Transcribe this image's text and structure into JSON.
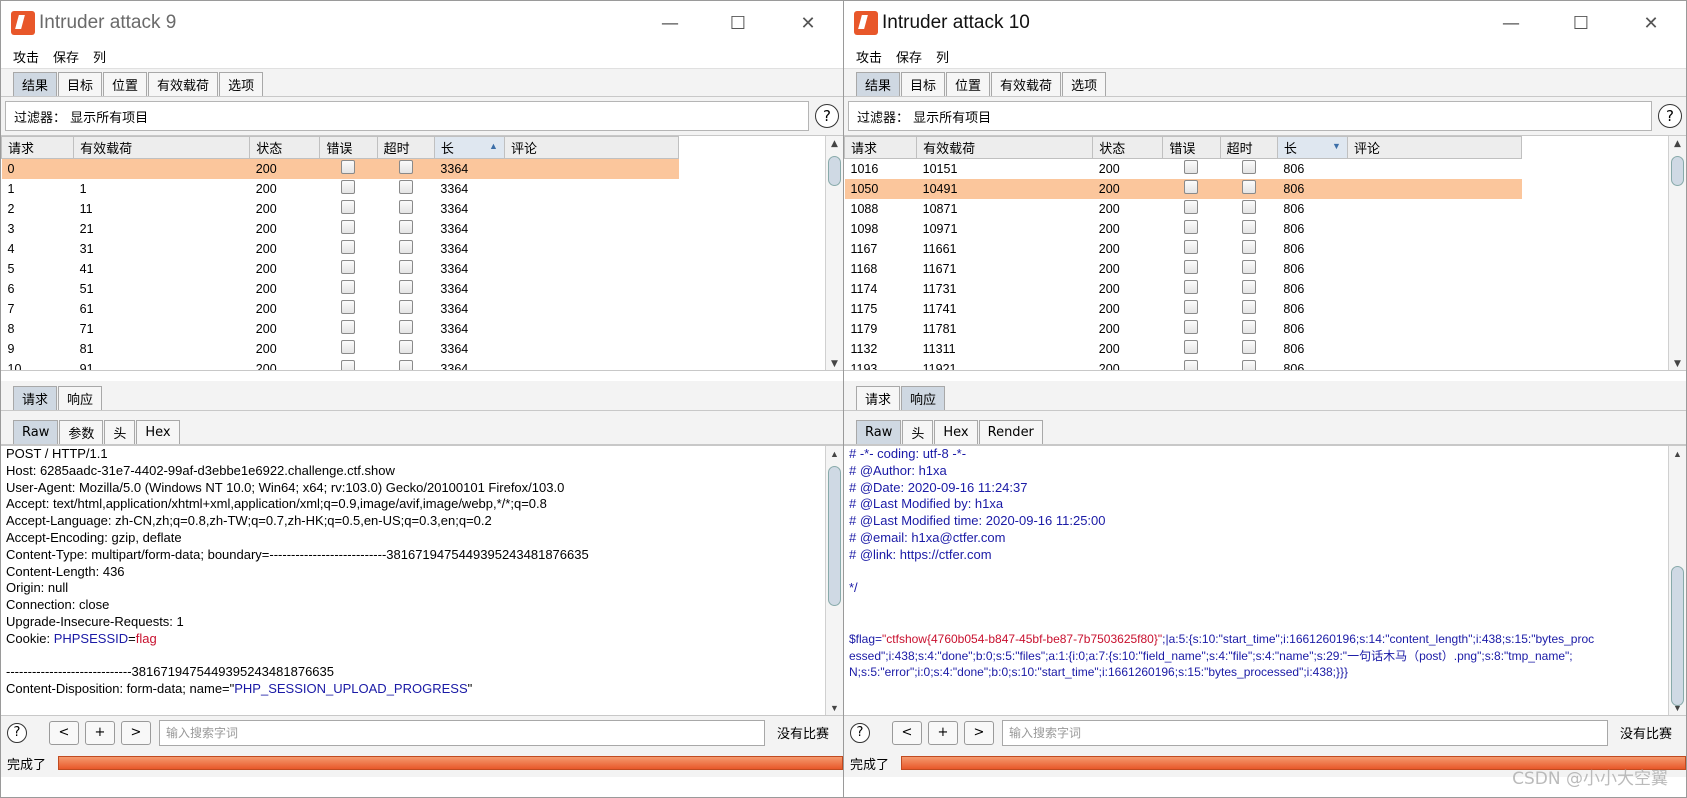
{
  "window1": {
    "title": "Intruder attack 9",
    "menu": [
      "攻击",
      "保存",
      "列"
    ],
    "tabs": [
      "结果",
      "目标",
      "位置",
      "有效载荷",
      "选项"
    ],
    "filter_label": "过滤器：  显示所有项目",
    "help_icon": "?",
    "columns": [
      "请求",
      "有效载荷",
      "状态",
      "错误",
      "超时",
      "长",
      "评论"
    ],
    "rows": [
      {
        "req": "0",
        "payload": "",
        "status": "200",
        "len": "3364",
        "selected": true
      },
      {
        "req": "1",
        "payload": "1",
        "status": "200",
        "len": "3364"
      },
      {
        "req": "2",
        "payload": "11",
        "status": "200",
        "len": "3364"
      },
      {
        "req": "3",
        "payload": "21",
        "status": "200",
        "len": "3364"
      },
      {
        "req": "4",
        "payload": "31",
        "status": "200",
        "len": "3364"
      },
      {
        "req": "5",
        "payload": "41",
        "status": "200",
        "len": "3364"
      },
      {
        "req": "6",
        "payload": "51",
        "status": "200",
        "len": "3364"
      },
      {
        "req": "7",
        "payload": "61",
        "status": "200",
        "len": "3364"
      },
      {
        "req": "8",
        "payload": "71",
        "status": "200",
        "len": "3364"
      },
      {
        "req": "9",
        "payload": "81",
        "status": "200",
        "len": "3364"
      },
      {
        "req": "10",
        "payload": "91",
        "status": "200",
        "len": "3364"
      }
    ],
    "sub_tabs": [
      "请求",
      "响应"
    ],
    "view_tabs": [
      "Raw",
      "参数",
      "头",
      "Hex"
    ],
    "request_lines": [
      "POST / HTTP/1.1",
      "Host: 6285aadc-31e7-4402-99af-d3ebbe1e6922.challenge.ctf.show",
      "User-Agent: Mozilla/5.0 (Windows NT 10.0; Win64; x64; rv:103.0) Gecko/20100101 Firefox/103.0",
      "Accept: text/html,application/xhtml+xml,application/xml;q=0.9,image/avif,image/webp,*/*;q=0.8",
      "Accept-Language: zh-CN,zh;q=0.8,zh-TW;q=0.7,zh-HK;q=0.5,en-US;q=0.3,en;q=0.2",
      "Accept-Encoding: gzip, deflate",
      "Content-Type: multipart/form-data; boundary=---------------------------3816719475449395243481876635",
      "Content-Length: 436",
      "Origin: null",
      "Connection: close",
      "Upgrade-Insecure-Requests: 1"
    ],
    "cookie_prefix": "Cookie: ",
    "cookie_name": "PHPSESSID",
    "cookie_eq": "=",
    "cookie_value": "flag",
    "boundary_line": "-----------------------------3816719475449395243481876635",
    "disposition_prefix": "Content-Disposition: form-data; name=\"",
    "disposition_name": "PHP_SESSION_UPLOAD_PROGRESS",
    "disposition_suffix": "\"",
    "nav_prev": "<",
    "nav_add": "+",
    "nav_next": ">",
    "search_placeholder": "输入搜索字词",
    "no_match": "没有比赛",
    "status": "完成了"
  },
  "window2": {
    "title": "Intruder attack 10",
    "menu": [
      "攻击",
      "保存",
      "列"
    ],
    "tabs": [
      "结果",
      "目标",
      "位置",
      "有效载荷",
      "选项"
    ],
    "filter_label": "过滤器：  显示所有项目",
    "help_icon": "?",
    "columns": [
      "请求",
      "有效载荷",
      "状态",
      "错误",
      "超时",
      "长",
      "评论"
    ],
    "rows": [
      {
        "req": "1016",
        "payload": "10151",
        "status": "200",
        "len": "806"
      },
      {
        "req": "1050",
        "payload": "10491",
        "status": "200",
        "len": "806",
        "selected": true
      },
      {
        "req": "1088",
        "payload": "10871",
        "status": "200",
        "len": "806"
      },
      {
        "req": "1098",
        "payload": "10971",
        "status": "200",
        "len": "806"
      },
      {
        "req": "1167",
        "payload": "11661",
        "status": "200",
        "len": "806"
      },
      {
        "req": "1168",
        "payload": "11671",
        "status": "200",
        "len": "806"
      },
      {
        "req": "1174",
        "payload": "11731",
        "status": "200",
        "len": "806"
      },
      {
        "req": "1175",
        "payload": "11741",
        "status": "200",
        "len": "806"
      },
      {
        "req": "1179",
        "payload": "11781",
        "status": "200",
        "len": "806"
      },
      {
        "req": "1132",
        "payload": "11311",
        "status": "200",
        "len": "806"
      },
      {
        "req": "1193",
        "payload": "11921",
        "status": "200",
        "len": "806"
      }
    ],
    "sub_tabs": [
      "请求",
      "响应"
    ],
    "view_tabs": [
      "Raw",
      "头",
      "Hex",
      "Render"
    ],
    "response_lines": [
      "# -*- coding: utf-8 -*-",
      "# @Author: h1xa",
      "# @Date:   2020-09-16 11:24:37",
      "# @Last Modified by:   h1xa",
      "# @Last Modified time: 2020-09-16 11:25:00",
      "# @email: h1xa@ctfer.com",
      "# @link: https://ctfer.com",
      "",
      "*/",
      "",
      ""
    ],
    "flag_var": "$flag=",
    "flag_value": "\"ctfshow{4760b054-b847-45bf-be87-7b7503625f80}\"",
    "flag_rest1": ";|a:5:{s:10:\"start_time\";i:1661260196;s:14:\"content_length\";i:438;s:15:\"bytes_proc",
    "flag_rest2": "essed\";i:438;s:4:\"done\";b:0;s:5:\"files\";a:1:{i:0;a:7:{s:10:\"field_name\";s:4:\"file\";s:4:\"name\";s:29:\"一句话木马（post）.png\";s:8:\"tmp_name\";",
    "flag_rest3": "N;s:5:\"error\";i:0;s:4:\"done\";b:0;s:10:\"start_time\";i:1661260196;s:15:\"bytes_processed\";i:438;}}}",
    "nav_prev": "<",
    "nav_add": "+",
    "nav_next": ">",
    "search_placeholder": "输入搜索字词",
    "no_match": "没有比赛",
    "status": "完成了",
    "watermark": "CSDN @小小大空翼"
  },
  "colors": {
    "selected_row": "#fbc69c",
    "progress": "#e8582a",
    "blue_text": "#1a1aa6",
    "red_text": "#c8102e"
  },
  "icons": {
    "minimize": "minimize-icon",
    "maximize": "maximize-icon",
    "close": "close-icon",
    "app": "burp-logo-icon",
    "sort": "sort-arrow-icon"
  }
}
